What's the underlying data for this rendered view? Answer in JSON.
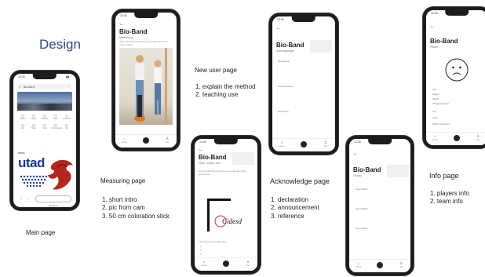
{
  "headings": {
    "design": "Design",
    "main_page": "Main page",
    "measuring_page": "Measuring page",
    "new_user_page": "New user page",
    "acknowledge_page": "Acknowledge page",
    "info_page": "Info page"
  },
  "lists": {
    "measuring": [
      "1. short intro",
      "2. pic from cam",
      "3. 50 cm coloration stick"
    ],
    "new_user": [
      "1. explain the method",
      "2. teaching use"
    ],
    "acknowledge": [
      "1.   declaration",
      "2.   announcement",
      "3.   reference"
    ],
    "info": [
      "1.   players info",
      "2.   team info"
    ]
  },
  "phone_common": {
    "time": "12:30",
    "battery": "▮▮ ◔",
    "back": "←",
    "app_title": "Bio-Band",
    "nav_home": "Home",
    "nav_center": "Measure",
    "nav_profile": "Me"
  },
  "main_phone": {
    "search": "Bio-Band",
    "section": "News",
    "grid_labels": [
      "Teams",
      "People",
      "Measure",
      "Stats",
      "Feedback",
      "Info",
      "Player",
      "Team",
      "Acknowledge",
      "Me"
    ],
    "logo_text": "utad",
    "button": "Measure"
  },
  "measuring_phone": {
    "subtitle": "Measuring",
    "intro": "Take a full body standing photo with the 50 cm stick in frame"
  },
  "newuser_phone": {
    "subtitle": "New / Users Info",
    "intro": "Use the Bio-Band technique to estimate body proportions",
    "brand": "Cidesd",
    "footer": "The steps are as following:",
    "steps": [
      "1.",
      "2.",
      "3."
    ]
  },
  "ack_phone": {
    "subtitle": "Acknowledge",
    "sections": [
      "Declaration",
      "Announcement",
      "Reference"
    ]
  },
  "group_phone": {
    "subtitle": "Group",
    "sections": [
      "Team INFO",
      "Team INFO",
      "Team INFO"
    ]
  },
  "info_phone": {
    "subtitle": "Player",
    "fields": [
      "Age",
      "Weight",
      "Height",
      "Wingspan height",
      "Sex",
      "Sport",
      "Player Preference"
    ]
  },
  "colors": {
    "utad_red": "#b3261e",
    "utad_blue": "#1c3b8f",
    "design_blue": "#2f4b7c",
    "phone_frame": "#1c1c1e"
  }
}
